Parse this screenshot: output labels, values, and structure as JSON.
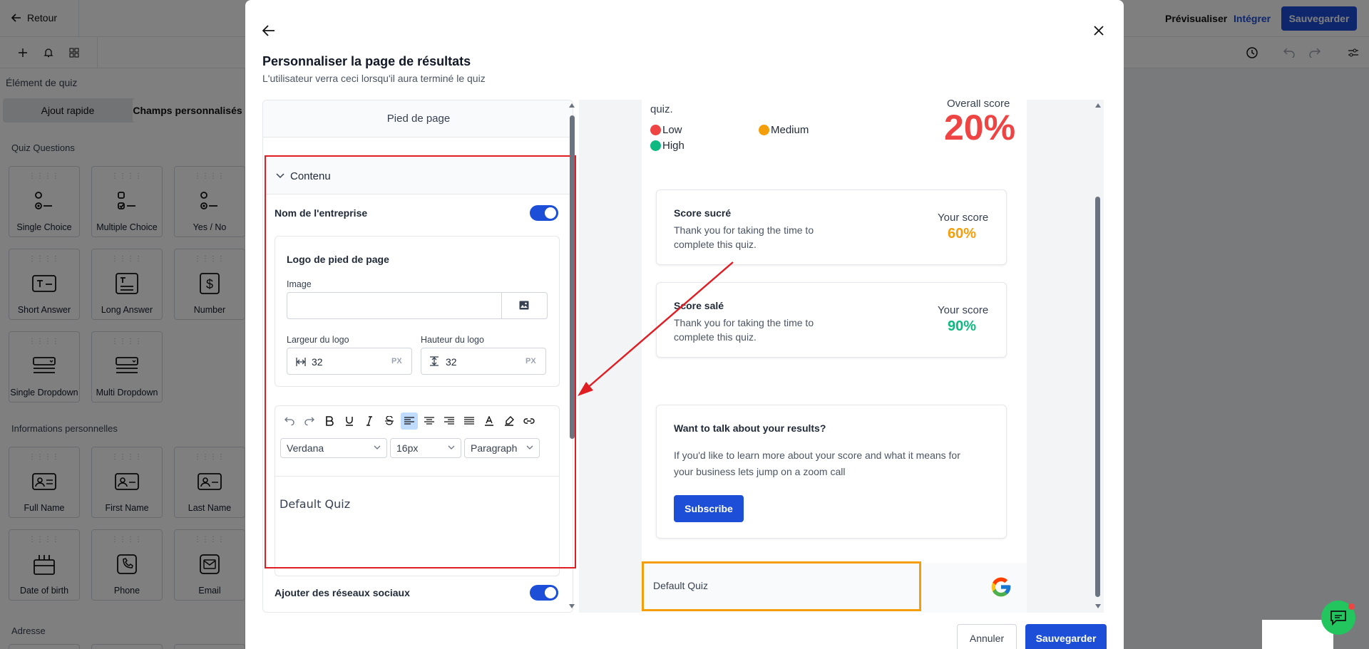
{
  "app": {
    "back_label": "Retour",
    "preview_label": "Prévisualiser",
    "integrate_label": "Intégrer",
    "save_label": "Sauvegarder"
  },
  "sidebar": {
    "title": "Élément de quiz",
    "tabs": [
      "Ajout rapide",
      "Champs personnalisés"
    ],
    "sections": [
      {
        "title": "Quiz Questions",
        "items": [
          "Single Choice",
          "Multiple Choice",
          "Yes / No",
          "Short Answer",
          "Long Answer",
          "Number",
          "Single Dropdown",
          "Multi Dropdown"
        ]
      },
      {
        "title": "Informations personnelles",
        "items": [
          "Full Name",
          "First Name",
          "Last Name",
          "Date of birth",
          "Phone",
          "Email"
        ]
      },
      {
        "title": "Adresse",
        "items": []
      }
    ]
  },
  "modal": {
    "title": "Personnaliser la page de résultats",
    "subtitle": "L'utilisateur verra ceci lorsqu'il aura terminé le quiz",
    "cancel_label": "Annuler",
    "save_label": "Sauvegarder",
    "left": {
      "section_header": "Pied de page",
      "accordion_label": "Contenu",
      "company_name_label": "Nom de l'entreprise",
      "company_name_enabled": true,
      "logo_section_title": "Logo de pied de page",
      "image_label": "Image",
      "image_value": "",
      "logo_width_label": "Largeur du logo",
      "logo_width_value": "32",
      "logo_height_label": "Hauteur du logo",
      "logo_height_value": "32",
      "unit": "PX",
      "editor": {
        "font": "Verdana",
        "size": "16px",
        "block": "Paragraph",
        "content": "Default Quiz"
      },
      "social_label": "Ajouter des réseaux sociaux",
      "social_enabled": true
    },
    "preview": {
      "intro_fragment": "quiz.",
      "overall_label": "Overall score",
      "overall_value": "20%",
      "legend": [
        {
          "label": "Low",
          "color": "#ef4444"
        },
        {
          "label": "Medium",
          "color": "#f59e0b"
        },
        {
          "label": "High",
          "color": "#10b981"
        }
      ],
      "scores": [
        {
          "title": "Score sucré",
          "text1": "Thank you for taking the time to",
          "text2": "complete this quiz.",
          "score_label": "Your score",
          "score_value": "60%",
          "color": "#f59e0b"
        },
        {
          "title": "Score salé",
          "text1": "Thank you for taking the time to",
          "text2": "complete this quiz.",
          "score_label": "Your score",
          "score_value": "90%",
          "color": "#10b981"
        }
      ],
      "cta": {
        "title": "Want to talk about your results?",
        "text1": "If you'd like to learn more about your score and what it means for",
        "text2": "your business lets jump on a zoom call",
        "button": "Subscribe"
      },
      "footer_text": "Default Quiz"
    }
  },
  "colors": {
    "accent": "#1d4ed8",
    "annotation_red": "#e11d24",
    "annotation_orange": "#f59e0b",
    "danger": "#ef4444",
    "success": "#10b981"
  }
}
